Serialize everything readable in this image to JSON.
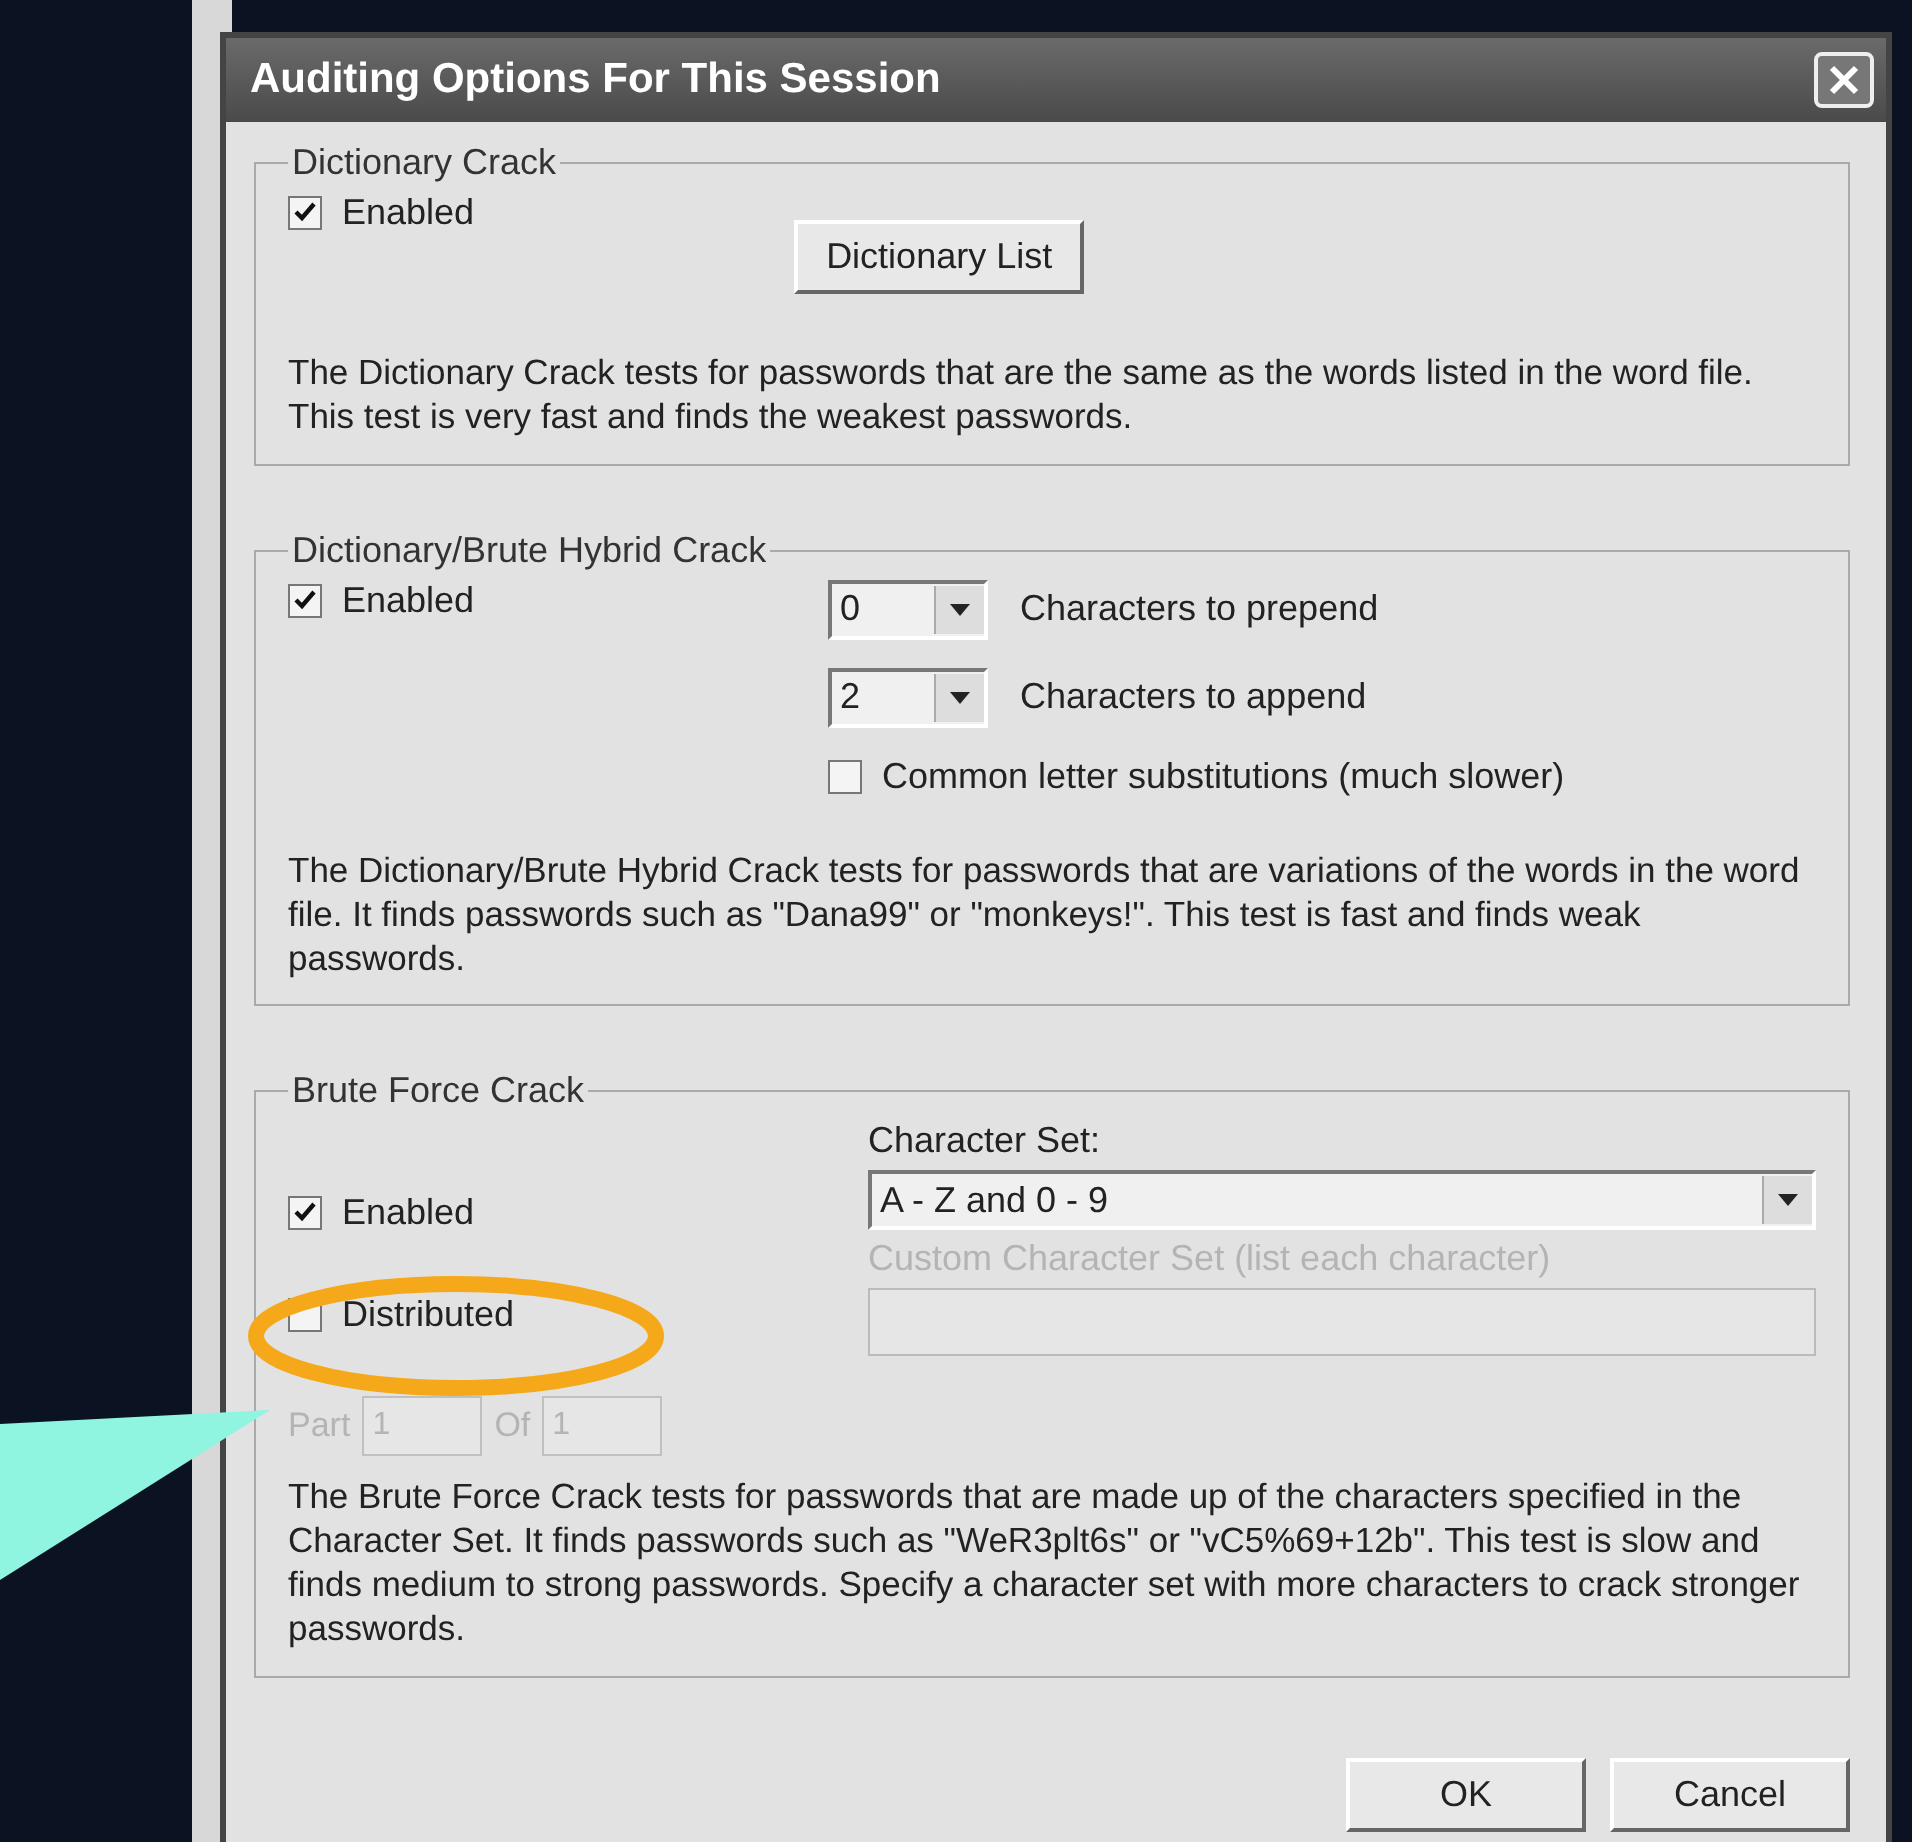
{
  "window": {
    "title": "Auditing Options For This Session"
  },
  "dictionary_crack": {
    "title": "Dictionary Crack",
    "enabled": {
      "label": "Enabled",
      "checked": true
    },
    "button": "Dictionary List",
    "description": "The Dictionary Crack tests for passwords that are the same as the words listed in the word file.  This test is very fast and finds the weakest passwords."
  },
  "hybrid_crack": {
    "title": "Dictionary/Brute Hybrid Crack",
    "enabled": {
      "label": "Enabled",
      "checked": true
    },
    "prepend": {
      "value": "0",
      "label": "Characters to prepend"
    },
    "append": {
      "value": "2",
      "label": "Characters to append"
    },
    "substitutions": {
      "label": "Common letter substitutions (much slower)",
      "checked": false
    },
    "description": "The Dictionary/Brute Hybrid Crack tests for passwords that are variations of the words in the word file. It finds passwords such as \"Dana99\" or \"monkeys!\". This test is fast and finds weak passwords."
  },
  "brute_force_crack": {
    "title": "Brute Force Crack",
    "enabled": {
      "label": "Enabled",
      "checked": true
    },
    "distributed": {
      "label": "Distributed",
      "checked": false
    },
    "part": {
      "label": "Part",
      "value": "1",
      "disabled": true
    },
    "of": {
      "label": "Of",
      "value": "1",
      "disabled": true
    },
    "character_set": {
      "label": "Character Set:",
      "value": "A - Z and 0 - 9"
    },
    "custom_set": {
      "label": "Custom Character Set (list each character)",
      "disabled": true
    },
    "description": "The Brute Force Crack tests for passwords that are made up of the characters specified in the Character Set. It finds passwords such as \"WeR3plt6s\" or \"vC5%69+12b\". This test is slow and finds medium to strong passwords. Specify a character set with more characters to crack stronger passwords."
  },
  "buttons": [
    {
      "label": "OK"
    },
    {
      "label": "Cancel"
    }
  ]
}
